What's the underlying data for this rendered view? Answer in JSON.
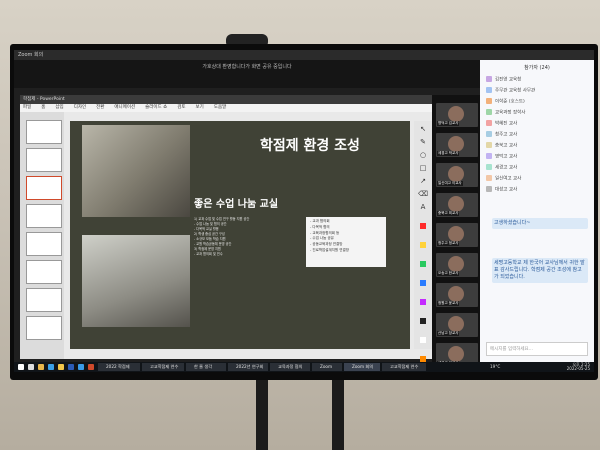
{
  "zoom": {
    "window_title": "Zoom 회의",
    "share_banner": "가호상대 환영합니다가 화면 공유 중입니다"
  },
  "ppt": {
    "window_title": "학점제 - PowerPoint",
    "menu": [
      "파일",
      "홈",
      "삽입",
      "디자인",
      "전환",
      "애니메이션",
      "슬라이드 쇼",
      "검토",
      "보기",
      "도움말"
    ]
  },
  "slide": {
    "title": "학점제 환경 조성",
    "subtitle": "좋은 수업 나눔 교실",
    "paragraph": [
      "1) 교과 수업 및 수업 연구 활동 지원 공간",
      "- 수업 나눔 및 협의 공간",
      "- 다목적 교실 활용",
      "2) 학생 중심 공간 구성",
      "- 소규모 모둠 학습 지원",
      "- 교원 학습공동체 운영 공간",
      "3) 학점제 운영 지원",
      "- 교과 협의회 및 연수"
    ],
    "bullets": [
      "- 교과 협의회",
      "- 다목적 협의",
      "- 교육과정협의회 등",
      "- 수업 나눔 공유",
      "- 공동교육과정 연결망",
      "- 진로학업설계지원 연결망"
    ]
  },
  "tools": [
    "cursor",
    "pen",
    "circle",
    "square",
    "arrow",
    "eraser",
    "text",
    "stamp",
    "redo"
  ],
  "tool_colors": [
    "#ff2a2a",
    "#ffd23a",
    "#29c95f",
    "#2a7cff",
    "#c42aff",
    "#222222",
    "#ffffff",
    "#ff8a00",
    "#00c4d8",
    "#ff66cc",
    "#7a4b2a",
    "#999999"
  ],
  "participants": [
    {
      "name": "명덕고 김교사"
    },
    {
      "name": "세경고 박교사"
    },
    {
      "name": "일신여고 이교사"
    },
    {
      "name": "충북고 최교사"
    },
    {
      "name": "청주고 정교사"
    },
    {
      "name": "오송고 한교사"
    },
    {
      "name": "청원고 윤교사"
    },
    {
      "name": "산남고 장교사"
    },
    {
      "name": "세광고 임교사"
    }
  ],
  "chat": {
    "title": "참가자 (24)",
    "people": [
      {
        "name": "김진영 교육청",
        "color": "#c7a7e3"
      },
      {
        "name": "주무관 교육청 사무관",
        "color": "#a2c3f2"
      },
      {
        "name": "이학준 (호스트)",
        "color": "#f2b07a"
      },
      {
        "name": "교육과정 장학사",
        "color": "#9ed6a7"
      },
      {
        "name": "박혜진 교사",
        "color": "#f2a2a2"
      },
      {
        "name": "청주고 교사",
        "color": "#a7cde3"
      },
      {
        "name": "충북고 교사",
        "color": "#e3d7a7"
      },
      {
        "name": "명덕고 교사",
        "color": "#c2b3f2"
      },
      {
        "name": "세경고 교사",
        "color": "#a7e3cf"
      },
      {
        "name": "일신여고 교사",
        "color": "#f2c7a7"
      },
      {
        "name": "대성고 교사",
        "color": "#b7b7b7"
      }
    ],
    "messages": [
      "고생하셨습니다~",
      "세명고등학교 제 한국어 교사님께서 귀한 발표 감사드립니다. 학점제 공간 조성에 참고가 되었습니다."
    ],
    "input_placeholder": "메시지를 입력하세요..."
  },
  "taskbar": {
    "items": [
      "2022 학점제",
      "고교학점제 연수",
      "한 줄 생각",
      "2022년 연구회",
      "교육과정 협의",
      "Zoom",
      "Zoom 회의",
      "고교학점제 연수"
    ],
    "time": "오후 2:25",
    "date": "2022-05-25",
    "temperature": "19°C"
  }
}
